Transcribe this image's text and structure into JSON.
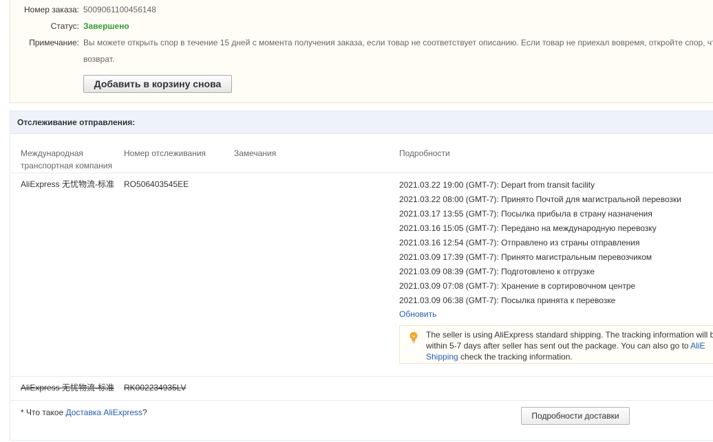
{
  "order": {
    "number_label": "Номер заказа:",
    "number_value": "5009061100456148",
    "status_label": "Статус:",
    "status_value": "Завершено",
    "note_label": "Примечание:",
    "note_line1": "Вы можете открыть спор в течение 15 дней с момента получения заказа, если товар не соответствует описанию. Если товар не приехал вовремя, откройте спор, чт",
    "note_line2": "возврат.",
    "readd_button": "Добавить в корзину снова"
  },
  "tracking": {
    "title": "Отслеживание отправления:",
    "columns": {
      "carrier_line1": "Международная",
      "carrier_line2": "транспортная компания",
      "tracking_number": "Номер отслеживания",
      "remarks": "Замечания",
      "details": "Подробности"
    },
    "shipment1": {
      "carrier": "AliExpress 无忧物流-标准",
      "tracking_number": "RO506403545EE",
      "events": [
        "2021.03.22 19:00 (GMT-7): Depart from transit facility",
        "2021.03.22 08:00 (GMT-7): Принято Почтой для магистральной перевозки",
        "2021.03.17 13:55 (GMT-7): Посылка прибыла в страну назначения",
        "2021.03.16 15:05 (GMT-7): Передано на международную перевозку",
        "2021.03.16 12:54 (GMT-7): Отправлено из страны отправления",
        "2021.03.09 17:39 (GMT-7): Принято магистральным перевозчиком",
        "2021.03.09 08:39 (GMT-7): Подготовлено к отгрузке",
        "2021.03.09 07:08 (GMT-7): Хранение в сортировочном центре",
        "2021.03.09 06:38 (GMT-7): Посылка принята к перевозке"
      ],
      "refresh_link": "Обновить",
      "notice": {
        "text_1": "The seller is using AliExpress standard shipping. The tracking information will b",
        "text_2": "within 5-7 days after seller has sent out the package. You can also go to ",
        "link_1": "AliE",
        "link_2": "Shipping",
        "text_3": " check the tracking information."
      }
    },
    "shipment2": {
      "carrier": "AliExpress 无忧物流-标准",
      "tracking_number": "RK002234935LV"
    },
    "footnote_prefix": "* Что такое ",
    "footnote_link": "Доставка AliExpress",
    "footnote_suffix": "?",
    "details_button": "Подробности доставки"
  },
  "colors": {
    "status_green": "#2f9e2f",
    "link_blue": "#1a5fb4",
    "header_bg": "#eef3fa",
    "order_bg": "#fffdf6",
    "bulb": "#f5a623"
  },
  "icons": {
    "notice_icon": "lightbulb-icon"
  }
}
